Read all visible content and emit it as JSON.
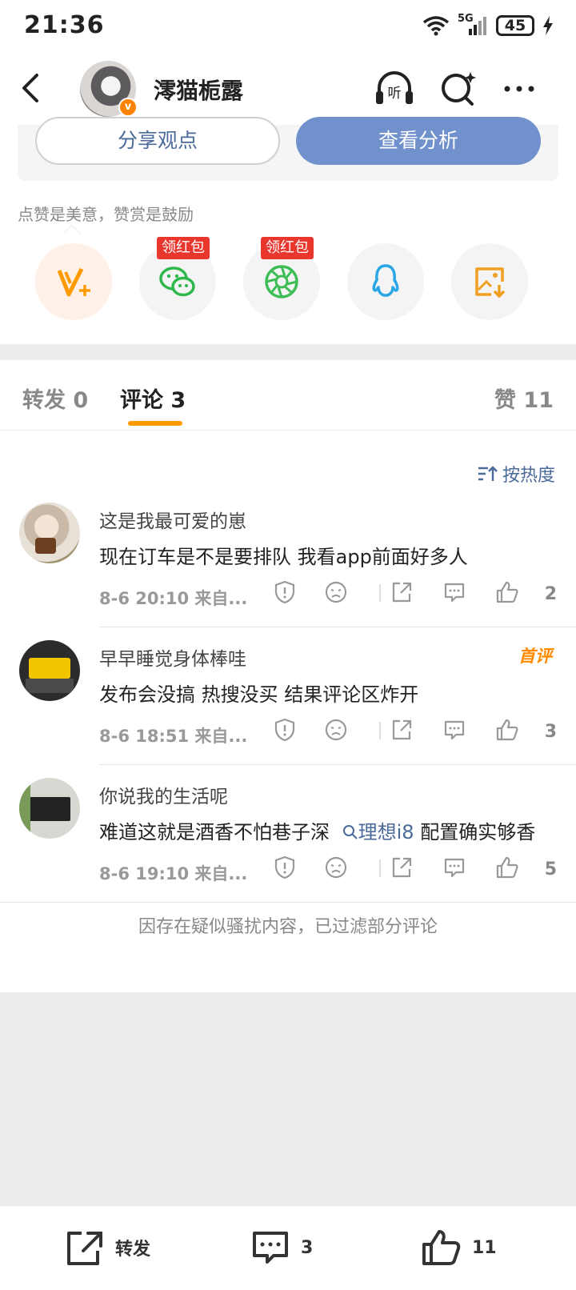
{
  "status_bar": {
    "time": "21:36",
    "network": "5G",
    "battery": "45"
  },
  "header": {
    "username": "澪猫栀露",
    "avatar_badge": "v"
  },
  "post_actions": {
    "share_label": "分享观点",
    "analysis_label": "查看分析"
  },
  "reward_hint": "点赞是美意，赞赏是鼓励",
  "share_targets": [
    {
      "name": "v-plus",
      "tag": ""
    },
    {
      "name": "wechat",
      "tag": "领红包"
    },
    {
      "name": "moments",
      "tag": "领红包"
    },
    {
      "name": "qq",
      "tag": ""
    },
    {
      "name": "save-image",
      "tag": ""
    }
  ],
  "tabs": {
    "repost": {
      "label": "转发",
      "count": "0"
    },
    "comment": {
      "label": "评论",
      "count": "3"
    },
    "like": {
      "label": "赞",
      "count": "11"
    }
  },
  "sort_label": "按热度",
  "comments": [
    {
      "name": "这是我最可爱的崽",
      "text": "现在订车是不是要排队 我看app前面好多人",
      "time": "8-6 20:10",
      "source": "来自...",
      "likes": "2",
      "badge": ""
    },
    {
      "name": "早早睡觉身体棒哇",
      "text": "发布会没搞 热搜没买 结果评论区炸开",
      "time": "8-6 18:51",
      "source": "来自...",
      "likes": "3",
      "badge": "首评"
    },
    {
      "name": "你说我的生活呢",
      "text_before": "难道这就是酒香不怕巷子深",
      "topic": "理想i8",
      "text_after": "配置确实够香",
      "time": "8-6 19:10",
      "source": "来自...",
      "likes": "5",
      "badge": ""
    }
  ],
  "filtered_notice": "因存在疑似骚扰内容，已过滤部分评论",
  "bottom_bar": {
    "repost_label": "转发",
    "comment_count": "3",
    "like_count": "11"
  },
  "colors": {
    "accent_orange": "#ff9a00",
    "link_blue": "#4a6a9a",
    "analysis_button": "#7191cc",
    "red_tag": "#e9372e"
  }
}
